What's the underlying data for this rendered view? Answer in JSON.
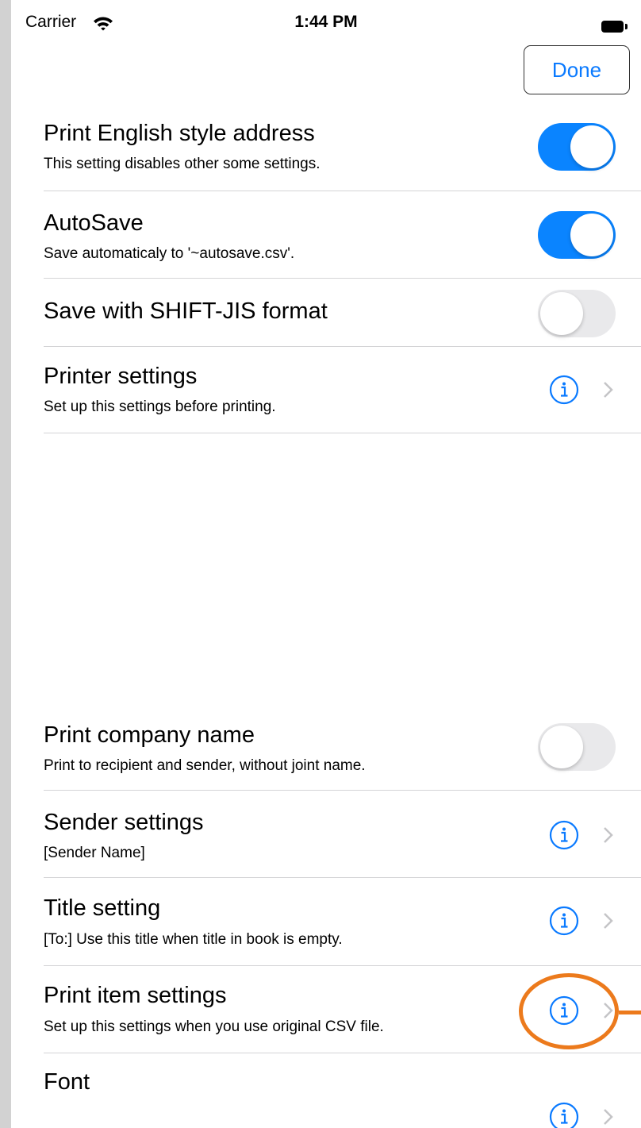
{
  "status_bar": {
    "carrier": "Carrier",
    "time": "1:44 PM"
  },
  "toolbar": {
    "done_label": "Done"
  },
  "settings": [
    {
      "title": "Print English style address",
      "subtitle": "This setting disables other some settings.",
      "control": "toggle",
      "state": "on"
    },
    {
      "title": "AutoSave",
      "subtitle": "Save automaticaly to '~autosave.csv'.",
      "control": "toggle",
      "state": "on"
    },
    {
      "title": "Save with SHIFT-JIS format",
      "subtitle": "",
      "control": "toggle",
      "state": "off"
    },
    {
      "title": "Printer settings",
      "subtitle": "Set up this settings before printing.",
      "control": "info-disclosure"
    },
    {
      "title": "Print company name",
      "subtitle": "Print to recipient and sender, without joint name.",
      "control": "toggle",
      "state": "off"
    },
    {
      "title": "Sender settings",
      "subtitle": "[Sender Name]",
      "control": "info-disclosure"
    },
    {
      "title": "Title setting",
      "subtitle": "[To:]  Use this title when title in book is empty.",
      "control": "info-disclosure"
    },
    {
      "title": "Print item settings",
      "subtitle": "Set up this settings when you use original CSV file.",
      "control": "info-disclosure",
      "highlighted": true
    },
    {
      "title": "Font",
      "subtitle": "",
      "control": "info-disclosure"
    }
  ],
  "colors": {
    "accent": "#0a84ff",
    "link": "#0a7aff",
    "highlight": "#ec7a1c"
  }
}
